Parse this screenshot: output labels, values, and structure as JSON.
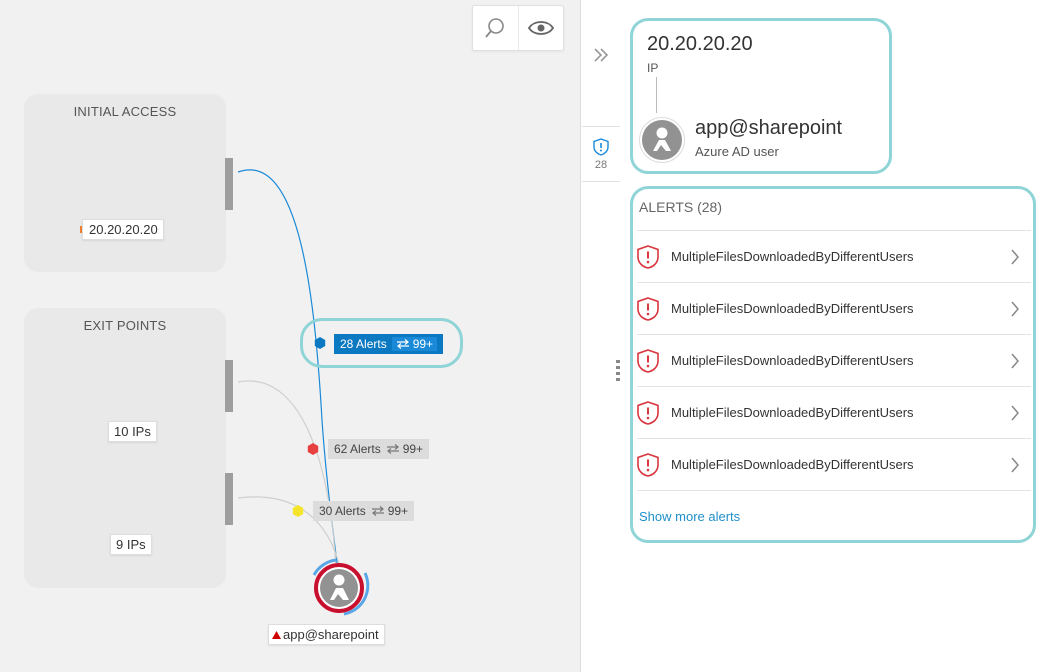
{
  "toolbar": {
    "search_icon": "search-icon",
    "eye_icon": "eye-icon"
  },
  "graph": {
    "initial_access": {
      "title": "INITIAL ACCESS",
      "ip_label": "20.20.20.20",
      "marker_color": "#f08030"
    },
    "exit_points": {
      "title": "EXIT POINTS",
      "group1_label": "10 IPs",
      "group2_label": "9 IPs"
    },
    "edges": [
      {
        "alerts": "28 Alerts",
        "count": "99+",
        "severity_color": "#0b78c2",
        "active": true
      },
      {
        "alerts": "62 Alerts",
        "count": "99+",
        "severity_color": "#e84040",
        "active": false
      },
      {
        "alerts": "30 Alerts",
        "count": "99+",
        "severity_color": "#f5e52a",
        "active": false
      }
    ],
    "user_node": {
      "label": "app@sharepoint",
      "marker_color": "#d00000"
    },
    "colors": {
      "active_edge": "#1a8ad8",
      "inactive_edge": "#cfcfcf",
      "highlight": "#8fd4d6",
      "initial_hex": "#f08030",
      "risk_ring": "#c8102e"
    }
  },
  "side_panel": {
    "collapse_icon": "double-chevron-right-icon",
    "alerts_tab_count": "28",
    "alerts_tab_icon": "shield-alert-icon"
  },
  "details": {
    "ip": "20.20.20.20",
    "ip_type": "IP",
    "user_name": "app@sharepoint",
    "user_type": "Azure AD user",
    "alerts_title": "ALERTS (28)",
    "alerts": [
      {
        "name": "MultipleFilesDownloadedByDifferentUsers"
      },
      {
        "name": "MultipleFilesDownloadedByDifferentUsers"
      },
      {
        "name": "MultipleFilesDownloadedByDifferentUsers"
      },
      {
        "name": "MultipleFilesDownloadedByDifferentUsers"
      },
      {
        "name": "MultipleFilesDownloadedByDifferentUsers"
      }
    ],
    "show_more": "Show more alerts"
  }
}
